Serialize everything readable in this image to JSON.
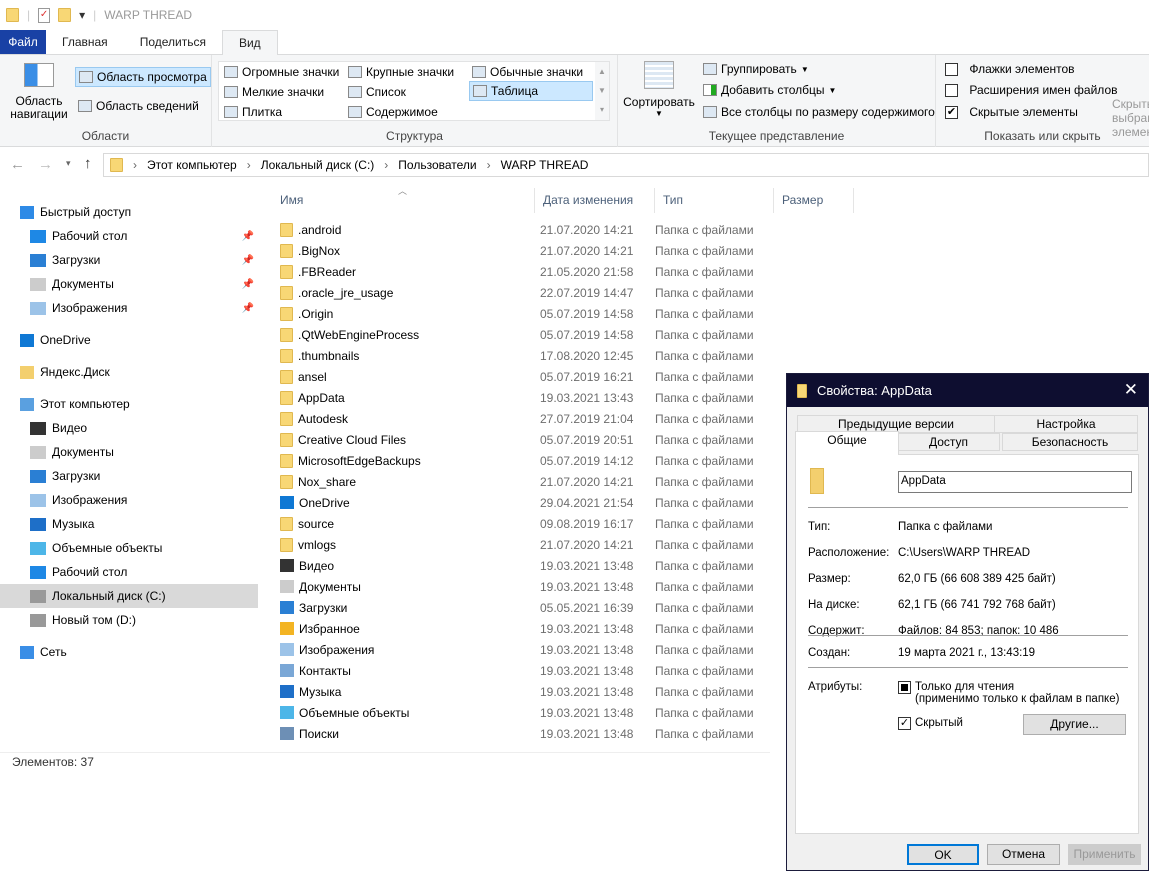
{
  "window": {
    "title": "WARP THREAD"
  },
  "ribbon_tabs": [
    "Файл",
    "Главная",
    "Поделиться",
    "Вид"
  ],
  "ribbon": {
    "areas": {
      "nav_pane": "Область навигации",
      "preview": "Область просмотра",
      "details": "Область сведений",
      "label": "Области"
    },
    "layout": {
      "items": [
        "Огромные значки",
        "Крупные значки",
        "Обычные значки",
        "Мелкие значки",
        "Список",
        "Таблица",
        "Плитка",
        "Содержимое"
      ],
      "selected": "Таблица",
      "label": "Структура"
    },
    "view": {
      "sort": "Сортировать",
      "group": "Группировать",
      "add_cols": "Добавить столбцы",
      "fit_cols": "Все столбцы по размеру содержимого",
      "label": "Текущее представление"
    },
    "show": {
      "checkboxes": [
        {
          "label": "Флажки элементов",
          "checked": false
        },
        {
          "label": "Расширения имен файлов",
          "checked": false
        },
        {
          "label": "Скрытые элементы",
          "checked": true
        }
      ],
      "hide_selected": "Скрыть выбранные элементы",
      "label": "Показать или скрыть"
    }
  },
  "breadcrumb": [
    "Этот компьютер",
    "Локальный диск (C:)",
    "Пользователи",
    "WARP THREAD"
  ],
  "sidebar": [
    {
      "label": "Быстрый доступ",
      "icon": "star-icon",
      "level": 0
    },
    {
      "label": "Рабочий стол",
      "icon": "desktop-icon",
      "level": 1,
      "pinned": true
    },
    {
      "label": "Загрузки",
      "icon": "download-icon",
      "level": 1,
      "pinned": true
    },
    {
      "label": "Документы",
      "icon": "document-icon",
      "level": 1,
      "pinned": true
    },
    {
      "label": "Изображения",
      "icon": "image-icon",
      "level": 1,
      "pinned": true
    },
    {
      "label": "OneDrive",
      "icon": "cloud-icon",
      "level": 0,
      "gap": true
    },
    {
      "label": "Яндекс.Диск",
      "icon": "folder-icon",
      "level": 0,
      "gap": true
    },
    {
      "label": "Этот компьютер",
      "icon": "computer-icon",
      "level": 0,
      "gap": true
    },
    {
      "label": "Видео",
      "icon": "video-icon",
      "level": 1
    },
    {
      "label": "Документы",
      "icon": "document-icon",
      "level": 1
    },
    {
      "label": "Загрузки",
      "icon": "download-icon",
      "level": 1
    },
    {
      "label": "Изображения",
      "icon": "image-icon",
      "level": 1
    },
    {
      "label": "Музыка",
      "icon": "music-icon",
      "level": 1
    },
    {
      "label": "Объемные объекты",
      "icon": "cube-icon",
      "level": 1
    },
    {
      "label": "Рабочий стол",
      "icon": "desktop-icon",
      "level": 1
    },
    {
      "label": "Локальный диск (C:)",
      "icon": "drive-icon",
      "level": 1,
      "selected": true
    },
    {
      "label": "Новый том (D:)",
      "icon": "drive-icon",
      "level": 1
    },
    {
      "label": "Сеть",
      "icon": "network-icon",
      "level": 0,
      "gap": true
    }
  ],
  "columns": [
    "Имя",
    "Дата изменения",
    "Тип",
    "Размер"
  ],
  "files": [
    [
      ".android",
      "21.07.2020 14:21",
      "Папка с файлами"
    ],
    [
      ".BigNox",
      "21.07.2020 14:21",
      "Папка с файлами"
    ],
    [
      ".FBReader",
      "21.05.2020 21:58",
      "Папка с файлами"
    ],
    [
      ".oracle_jre_usage",
      "22.07.2019 14:47",
      "Папка с файлами"
    ],
    [
      ".Origin",
      "05.07.2019 14:58",
      "Папка с файлами"
    ],
    [
      ".QtWebEngineProcess",
      "05.07.2019 14:58",
      "Папка с файлами"
    ],
    [
      ".thumbnails",
      "17.08.2020 12:45",
      "Папка с файлами"
    ],
    [
      "ansel",
      "05.07.2019 16:21",
      "Папка с файлами"
    ],
    [
      "AppData",
      "19.03.2021 13:43",
      "Папка с файлами"
    ],
    [
      "Autodesk",
      "27.07.2019 21:04",
      "Папка с файлами"
    ],
    [
      "Creative Cloud Files",
      "05.07.2019 20:51",
      "Папка с файлами"
    ],
    [
      "MicrosoftEdgeBackups",
      "05.07.2019 14:12",
      "Папка с файлами"
    ],
    [
      "Nox_share",
      "21.07.2020 14:21",
      "Папка с файлами"
    ],
    [
      "OneDrive",
      "29.04.2021 21:54",
      "Папка с файлами"
    ],
    [
      "source",
      "09.08.2019 16:17",
      "Папка с файлами"
    ],
    [
      "vmlogs",
      "21.07.2020 14:21",
      "Папка с файлами"
    ],
    [
      "Видео",
      "19.03.2021 13:48",
      "Папка с файлами"
    ],
    [
      "Документы",
      "19.03.2021 13:48",
      "Папка с файлами"
    ],
    [
      "Загрузки",
      "05.05.2021 16:39",
      "Папка с файлами"
    ],
    [
      "Избранное",
      "19.03.2021 13:48",
      "Папка с файлами"
    ],
    [
      "Изображения",
      "19.03.2021 13:48",
      "Папка с файлами"
    ],
    [
      "Контакты",
      "19.03.2021 13:48",
      "Папка с файлами"
    ],
    [
      "Музыка",
      "19.03.2021 13:48",
      "Папка с файлами"
    ],
    [
      "Объемные объекты",
      "19.03.2021 13:48",
      "Папка с файлами"
    ],
    [
      "Поиски",
      "19.03.2021 13:48",
      "Папка с файлами"
    ]
  ],
  "status": "Элементов: 37",
  "dialog": {
    "title": "Свойства: AppData",
    "tabs_top": [
      "Предыдущие версии",
      "Настройка"
    ],
    "tabs_bottom": [
      "Общие",
      "Доступ",
      "Безопасность"
    ],
    "active_tab": "Общие",
    "name": "AppData",
    "props": [
      [
        "Тип:",
        "Папка с файлами"
      ],
      [
        "Расположение:",
        "C:\\Users\\WARP THREAD"
      ],
      [
        "Размер:",
        "62,0 ГБ (66 608 389 425 байт)"
      ],
      [
        "На диске:",
        "62,1 ГБ (66 741 792 768 байт)"
      ],
      [
        "Содержит:",
        "Файлов: 84 853; папок: 10 486"
      ]
    ],
    "created_label": "Создан:",
    "created": "19 марта 2021 г., 13:43:19",
    "attr_label": "Атрибуты:",
    "readonly": "Только для чтения",
    "readonly_note": "(применимо только к файлам в папке)",
    "hidden": "Скрытый",
    "hidden_checked": true,
    "other": "Другие...",
    "ok": "OK",
    "cancel": "Отмена",
    "apply": "Применить"
  },
  "colors": {
    "file_tab": "#1941a5",
    "selection": "#cce8ff",
    "dialog_title": "#0e0e30"
  }
}
